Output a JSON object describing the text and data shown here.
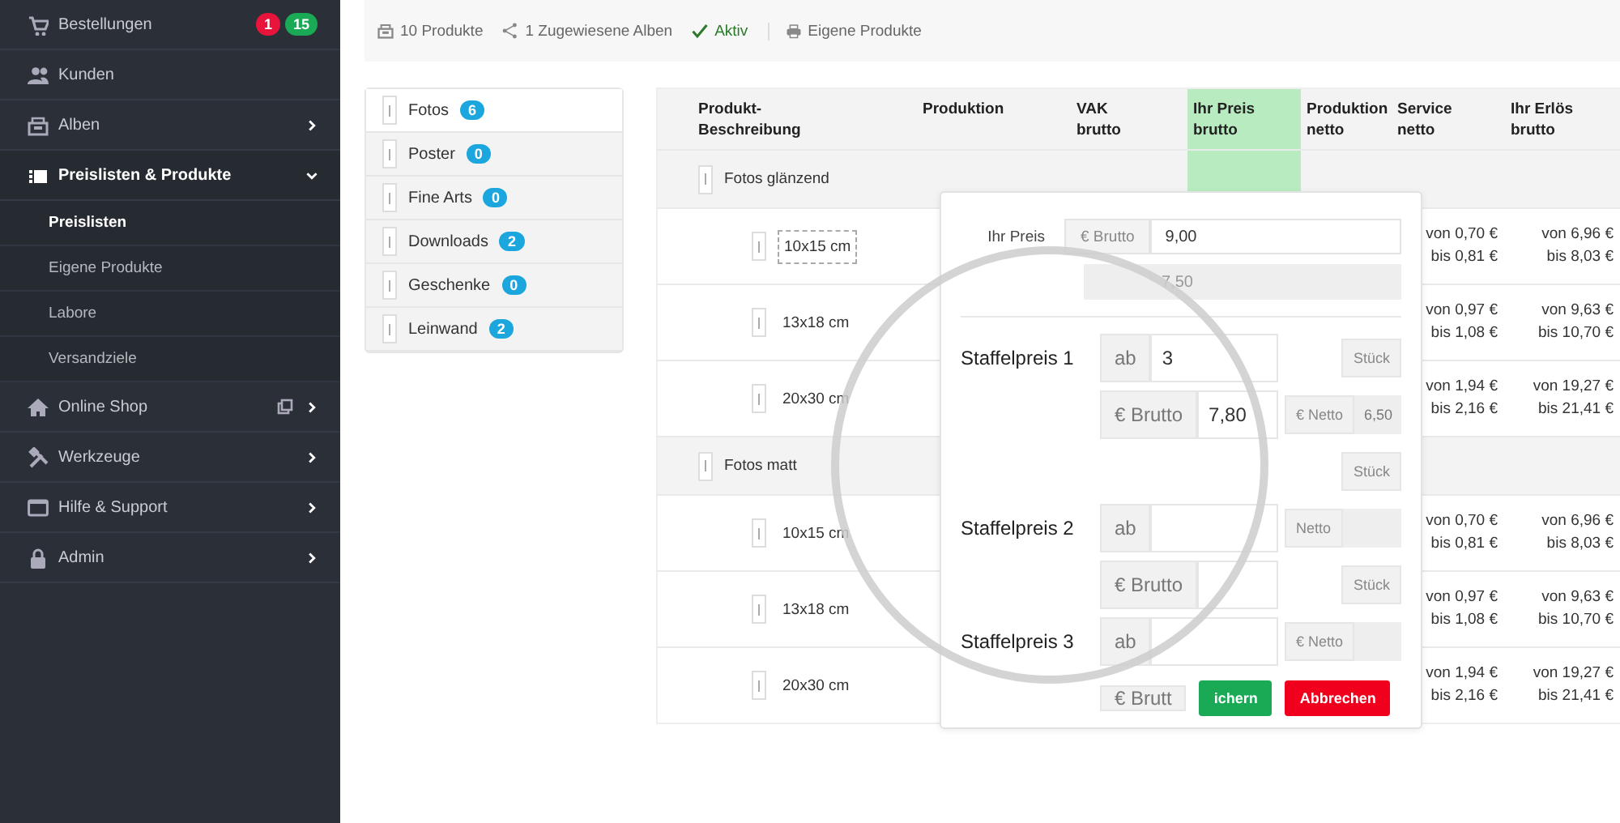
{
  "sidebar": {
    "items": [
      {
        "label": "Bestellungen",
        "badges": [
          {
            "text": "1",
            "color": "#e8143c"
          },
          {
            "text": "15",
            "color": "#1aaa55"
          }
        ],
        "expandable": false,
        "expanded": false,
        "external_link": false
      },
      {
        "label": "Kunden",
        "expandable": false,
        "expanded": false,
        "external_link": false
      },
      {
        "label": "Alben",
        "expandable": true,
        "expanded": false,
        "external_link": false
      },
      {
        "label": "Preislisten & Produkte",
        "expandable": true,
        "expanded": true,
        "external_link": false,
        "children": [
          {
            "label": "Preislisten",
            "selected": true
          },
          {
            "label": "Eigene Produkte",
            "selected": false
          },
          {
            "label": "Labore",
            "selected": false
          },
          {
            "label": "Versandziele",
            "selected": false
          }
        ]
      },
      {
        "label": "Online Shop",
        "expandable": true,
        "expanded": false,
        "external_link": true
      },
      {
        "label": "Werkzeuge",
        "expandable": true,
        "expanded": false,
        "external_link": false
      },
      {
        "label": "Hilfe & Support",
        "expandable": true,
        "expanded": false,
        "external_link": false
      },
      {
        "label": "Admin",
        "expandable": true,
        "expanded": false,
        "external_link": false
      }
    ]
  },
  "toolbar": {
    "items": [
      {
        "kind": "info",
        "text": "10 Produkte"
      },
      {
        "kind": "info",
        "text": "1 Zugewiesene Alben"
      },
      {
        "kind": "status",
        "text": "Aktiv"
      },
      {
        "kind": "link",
        "text": "Eigene Produkte"
      }
    ]
  },
  "categories": [
    {
      "label": "Fotos",
      "count": "6",
      "selected": true
    },
    {
      "label": "Poster",
      "count": "0",
      "selected": false
    },
    {
      "label": "Fine Arts",
      "count": "0",
      "selected": false
    },
    {
      "label": "Downloads",
      "count": "2",
      "selected": false
    },
    {
      "label": "Geschenke",
      "count": "0",
      "selected": false
    },
    {
      "label": "Leinwand",
      "count": "2",
      "selected": false
    }
  ],
  "table": {
    "columns": [
      {
        "label": "Produkt-\nBeschreibung",
        "highlighted": false
      },
      {
        "label": "Produktion",
        "highlighted": false
      },
      {
        "label": "VAK\nbrutto",
        "highlighted": false
      },
      {
        "label": "Ihr Preis\nbrutto",
        "highlighted": true
      },
      {
        "label": "Produktion\nnetto",
        "highlighted": false
      },
      {
        "label": "Service\nnetto",
        "highlighted": false
      },
      {
        "label": "Ihr Erlös\nbrutto",
        "highlighted": false
      }
    ],
    "rows": [
      {
        "kind": "group",
        "label": "Fotos glänzend"
      },
      {
        "kind": "product",
        "label": "10x15 cm",
        "focused": true,
        "service": [
          "von 0,70 €",
          "bis 0,81 €"
        ],
        "revenue": [
          "von 6,96 €",
          "bis 8,03 €"
        ]
      },
      {
        "kind": "product",
        "label": "13x18 cm",
        "focused": false,
        "service": [
          "von 0,97 €",
          "bis 1,08 €"
        ],
        "revenue": [
          "von 9,63 €",
          "bis 10,70 €"
        ]
      },
      {
        "kind": "product",
        "label": "20x30 cm",
        "focused": false,
        "service": [
          "von 1,94 €",
          "bis 2,16 €"
        ],
        "revenue": [
          "von 19,27 €",
          "bis 21,41 €"
        ]
      },
      {
        "kind": "group",
        "label": "Fotos matt"
      },
      {
        "kind": "product",
        "label": "10x15 cm",
        "focused": false,
        "service": [
          "von 0,70 €",
          "bis 0,81 €"
        ],
        "revenue": [
          "von 6,96 €",
          "bis 8,03 €"
        ]
      },
      {
        "kind": "product",
        "label": "13x18 cm",
        "focused": false,
        "service": [
          "von 0,97 €",
          "bis 1,08 €"
        ],
        "revenue": [
          "von 9,63 €",
          "bis 10,70 €"
        ]
      },
      {
        "kind": "product",
        "label": "20x30 cm",
        "focused": false,
        "service": [
          "von 1,94 €",
          "bis 2,16 €"
        ],
        "revenue": [
          "von 19,27 €",
          "bis 21,41 €"
        ]
      }
    ]
  },
  "popup": {
    "price_label": "Ihr Preis",
    "price_addon": "€ Brutto",
    "price_value": "9,00",
    "net_value": "7,50",
    "rows": [
      {
        "label": "Staffelpreis 1",
        "addon": "ab",
        "value": "3",
        "side": {
          "kind": "unit",
          "text": "Stück"
        }
      },
      {
        "addon": "€ Brutto",
        "value": "7,80",
        "side": {
          "kind": "net",
          "text": "€ Netto",
          "value": "6,50"
        }
      },
      {
        "side": {
          "kind": "unit",
          "text": "Stück"
        }
      },
      {
        "label": "Staffelpreis 2",
        "addon": "ab",
        "side": {
          "kind": "net",
          "text": "Netto"
        }
      },
      {
        "addon": "€ Brutto",
        "side": {
          "kind": "unit",
          "text": "Stück"
        }
      },
      {
        "label": "Staffelpreis 3",
        "addon": "ab",
        "side": {
          "kind": "net",
          "text": "€ Netto"
        }
      },
      {
        "addon": "€ Brutt",
        "buttons": [
          {
            "kind": "save",
            "label": "ichern"
          },
          {
            "kind": "cancel",
            "label": "Abbrechen"
          }
        ]
      }
    ]
  }
}
